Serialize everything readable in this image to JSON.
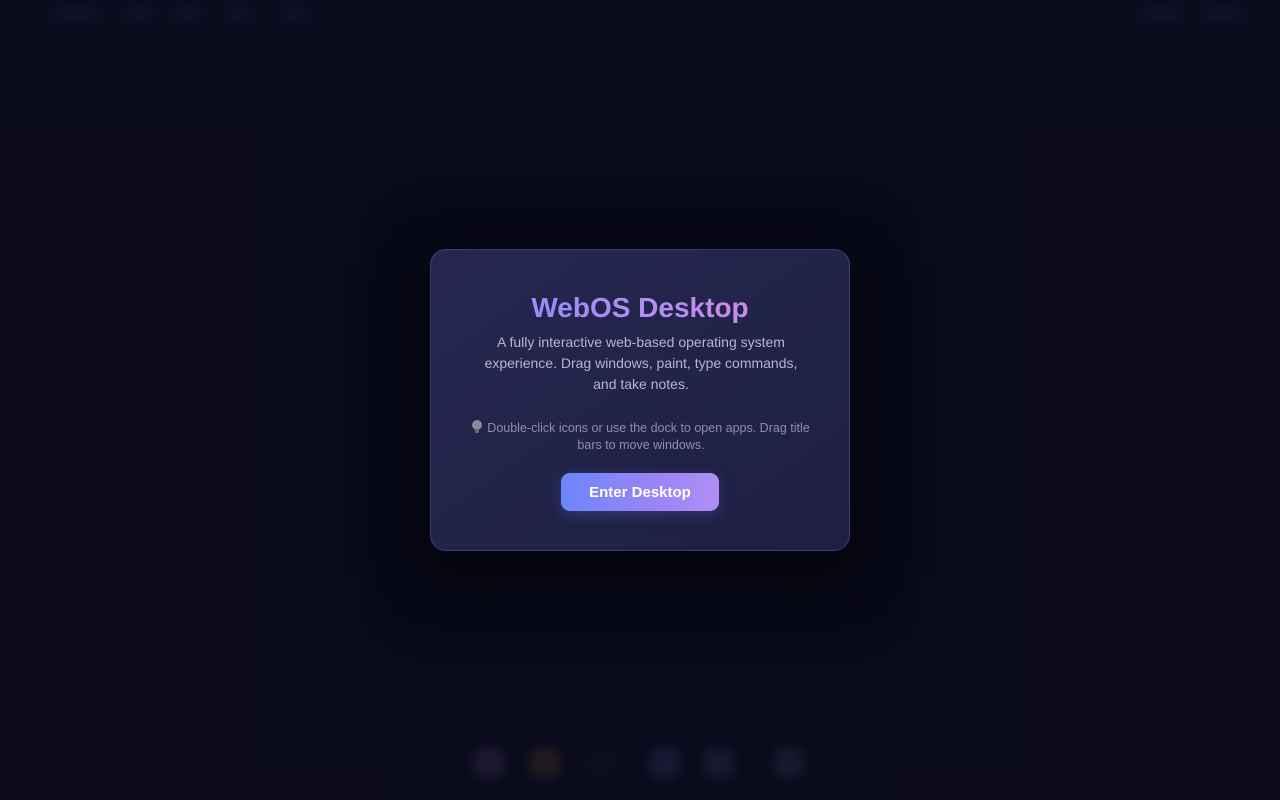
{
  "welcome": {
    "title": "WebOS Desktop",
    "description": "A fully interactive web-based operating system experience. Drag windows, paint, type commands, and take notes.",
    "hint": "Double-click icons or use the dock to open apps. Drag title bars to move windows.",
    "hint_icon": "lightbulb-icon",
    "button_label": "Enter Desktop"
  },
  "colors": {
    "background": "#0c0d20",
    "card": "#23244a",
    "title_gradient_start": "#7d8cff",
    "title_gradient_end": "#e08ad6",
    "button_gradient_start": "#6d86fb",
    "button_gradient_end": "#b08ff3"
  },
  "dock": {
    "icons": [
      "app-icon",
      "paint-icon",
      "terminal-icon",
      "folder-icon",
      "notes-icon",
      "settings-icon"
    ]
  }
}
